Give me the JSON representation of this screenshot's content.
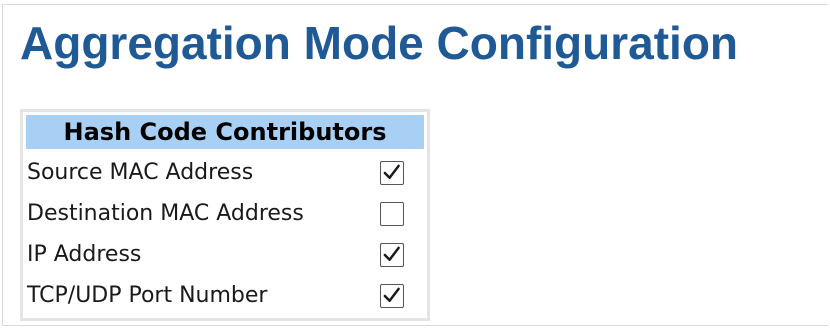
{
  "page": {
    "title": "Aggregation Mode Configuration"
  },
  "hash_code_contributors": {
    "header": "Hash Code Contributors",
    "rows": [
      {
        "label": "Source MAC Address",
        "checked": true
      },
      {
        "label": "Destination MAC Address",
        "checked": false
      },
      {
        "label": "IP Address",
        "checked": true
      },
      {
        "label": "TCP/UDP Port Number",
        "checked": true
      }
    ]
  },
  "colors": {
    "title": "#1f5a96",
    "header_bg": "#a8d0f5",
    "panel_border": "#e4e4e4",
    "checkbox_border": "#555555",
    "check_mark": "#1a1a1a"
  },
  "icons": {
    "checked": "check-mark-icon"
  }
}
